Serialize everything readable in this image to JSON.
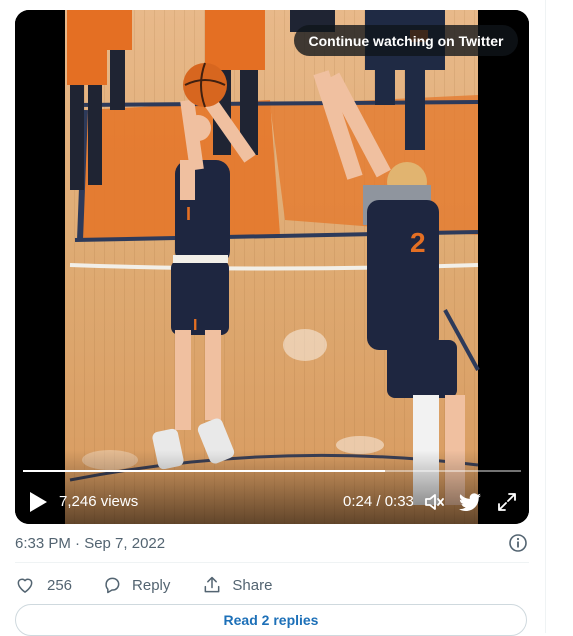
{
  "video": {
    "continue_label": "Continue watching on Twitter",
    "views": "7,246 views",
    "timecode": "0:24 / 0:33",
    "progress": 0.727
  },
  "tweet": {
    "timestamp": "6:33 PM · Sep 7, 2022",
    "like_count": "256",
    "reply_label": "Reply",
    "share_label": "Share",
    "read_replies_label": "Read 2 replies"
  },
  "colors": {
    "text_secondary": "#536471",
    "link": "#1d70b8",
    "divider": "#eff3f4"
  },
  "icons": [
    "play-icon",
    "volume-icon",
    "twitter-bird-icon",
    "fullscreen-icon",
    "info-icon",
    "heart-icon",
    "reply-bubble-icon",
    "share-icon"
  ]
}
